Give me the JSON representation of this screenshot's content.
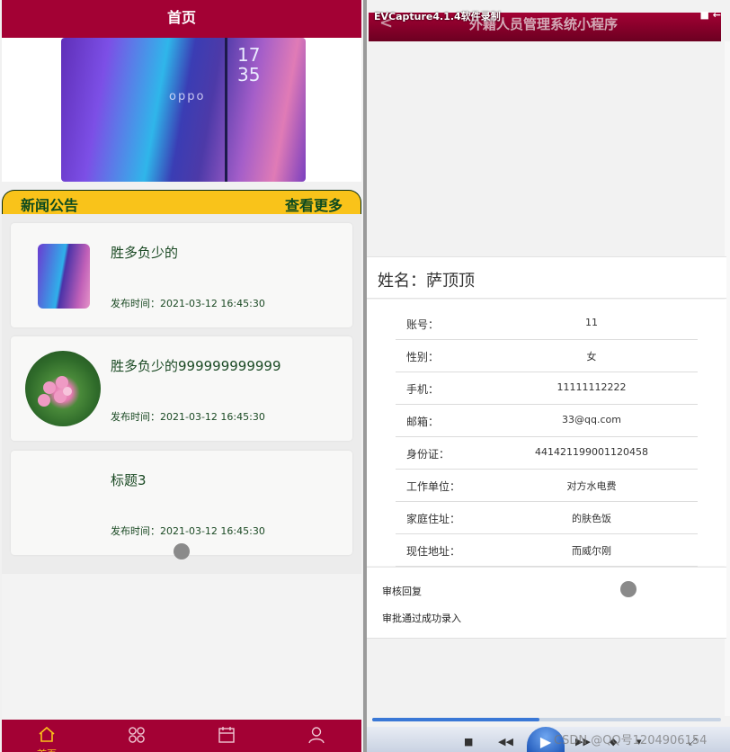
{
  "left": {
    "header_title": "首页",
    "banner": {
      "brand": "oppo",
      "clock": "17\n35",
      "slide_count": 2,
      "active_slide": 1
    },
    "news": {
      "title": "新闻公告",
      "more": "查看更多"
    },
    "cards": [
      {
        "title": "胜多负少的",
        "time": "发布时间：2021-03-12 16:45:30",
        "thumb": "phone-image"
      },
      {
        "title": "胜多负少的999999999999",
        "time": "发布时间：2021-03-12 16:45:30",
        "thumb": "flower-image"
      },
      {
        "title": "标题3",
        "time": "发布时间：2021-03-12 16:45:30",
        "thumb": "none"
      }
    ],
    "tabbar": [
      {
        "label": "首页",
        "icon": "home-icon",
        "active": true
      },
      {
        "label": "",
        "icon": "grid-icon",
        "active": false
      },
      {
        "label": "",
        "icon": "calendar-icon",
        "active": false
      },
      {
        "label": "",
        "icon": "user-icon",
        "active": false
      }
    ]
  },
  "right": {
    "recorder_title": "EVCapture4.1.4软件录制",
    "recorder_ctrl": "■ ←",
    "header_title": "外籍人员管理系统小程序",
    "name_label": "姓名：萨顶顶",
    "rows": [
      {
        "label": "账号：",
        "value": "11"
      },
      {
        "label": "性别：",
        "value": "女"
      },
      {
        "label": "手机：",
        "value": "11111112222"
      },
      {
        "label": "邮箱：",
        "value": "33@qq.com"
      },
      {
        "label": "身份证：",
        "value": "441421199001120458"
      },
      {
        "label": "工作单位：",
        "value": "对方水电费"
      },
      {
        "label": "家庭住址：",
        "value": "的肤色饭"
      },
      {
        "label": "现住地址：",
        "value": "而威尔刚"
      }
    ],
    "reply_label": "审核回复",
    "reply_text": "审批通过成功录入",
    "player": {
      "progress": 0.48,
      "watermark": "CSDN @QQ号1204906154"
    }
  },
  "colors": {
    "brand": "#a30134",
    "accent_yellow": "#f9c31a",
    "text_green": "#1b4a24"
  }
}
